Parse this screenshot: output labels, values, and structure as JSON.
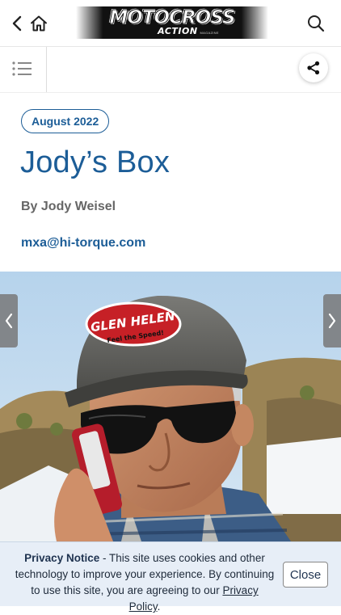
{
  "header": {
    "logo_line1": "MOTOCROSS",
    "logo_line2": "ACTION",
    "logo_line3": "MAGAZINE",
    "icons": [
      "back-chevron-icon",
      "home-icon",
      "search-icon"
    ]
  },
  "toolbar": {
    "icons": [
      "list-menu-icon",
      "share-icon"
    ]
  },
  "article": {
    "date": "August 2022",
    "title": "Jody’s Box",
    "author": "By Jody Weisel",
    "email": "mxa@hi-torque.com"
  },
  "hero": {
    "cap_brand": "GLEN HELEN",
    "cap_slogan": "Feel the Speed!",
    "nav_icons": [
      "chevron-left-icon",
      "chevron-right-icon"
    ]
  },
  "privacy": {
    "title": "Privacy Notice",
    "text_before": " - This site uses cookies and other technology to improve your experience. By continuing to use this site, you are agreeing to our ",
    "link": "Privacy Policy",
    "text_after": ".",
    "close_label": "Close"
  },
  "colors": {
    "accent": "#1c5d97",
    "privacy_bg": "#e7eef7"
  }
}
